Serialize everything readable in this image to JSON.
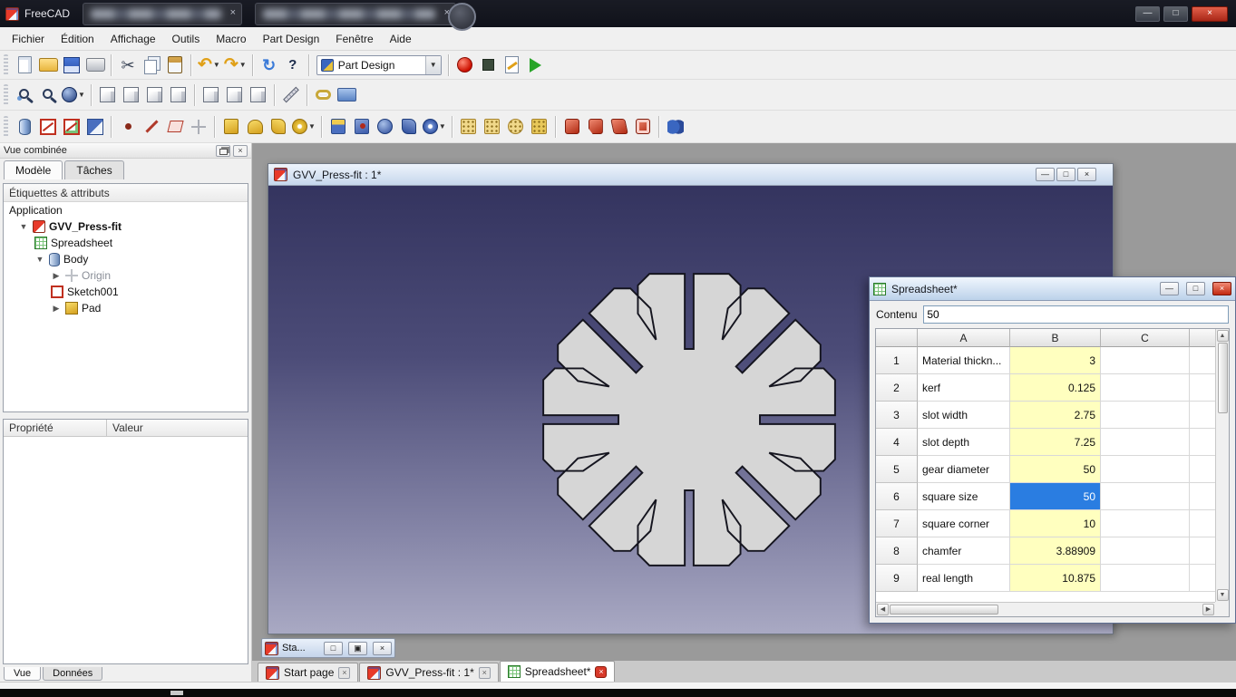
{
  "app": {
    "title": "FreeCAD"
  },
  "menubar": {
    "items": [
      "Fichier",
      "Édition",
      "Affichage",
      "Outils",
      "Macro",
      "Part Design",
      "Fenêtre",
      "Aide"
    ]
  },
  "toolbar": {
    "workbench": "Part Design"
  },
  "toolbars": {
    "row1a": [
      "grip",
      {
        "name": "new-file-button",
        "kind": "page"
      },
      {
        "name": "open-file-button",
        "kind": "folder"
      },
      {
        "name": "save-button",
        "kind": "floppy"
      },
      {
        "name": "print-button",
        "kind": "printer"
      },
      "sep",
      {
        "name": "cut-button",
        "kind": "scissors"
      },
      {
        "name": "copy-button",
        "kind": "copy"
      },
      {
        "name": "paste-button",
        "kind": "paste"
      },
      "sep",
      {
        "name": "undo-button",
        "kind": "undo",
        "drop": true
      },
      {
        "name": "redo-button",
        "kind": "redo",
        "drop": true
      },
      "sep",
      {
        "name": "refresh-button",
        "kind": "refresh"
      },
      {
        "name": "whats-this-button",
        "kind": "whatsthis"
      },
      "sep"
    ],
    "row1b": [
      "sep",
      {
        "name": "macro-record-button",
        "kind": "record"
      },
      {
        "name": "macro-stop-button",
        "kind": "stop"
      },
      {
        "name": "macro-edit-button",
        "kind": "macroedit"
      },
      {
        "name": "macro-run-button",
        "kind": "play"
      }
    ],
    "row2": [
      "grip",
      {
        "name": "fit-all-button",
        "kind": "magbox"
      },
      {
        "name": "zoom-selection-button",
        "kind": "mag"
      },
      {
        "name": "draw-style-button",
        "kind": "sphere",
        "drop": true
      },
      "sep",
      {
        "name": "view-axonometric-button",
        "kind": "cube"
      },
      {
        "name": "view-front-button",
        "kind": "cube"
      },
      {
        "name": "view-top-button",
        "kind": "cube"
      },
      {
        "name": "view-right-button",
        "kind": "cube"
      },
      "sep",
      {
        "name": "view-rear-button",
        "kind": "cube"
      },
      {
        "name": "view-bottom-button",
        "kind": "cube"
      },
      {
        "name": "view-left-button",
        "kind": "cube"
      },
      "sep",
      {
        "name": "measure-button",
        "kind": "measure"
      },
      "sep",
      {
        "name": "make-link-button",
        "kind": "link"
      },
      {
        "name": "link-group-button",
        "kind": "linkfolder"
      }
    ],
    "row3": [
      "grip",
      {
        "name": "create-body-button",
        "kind": "body"
      },
      {
        "name": "create-sketch-button",
        "kind": "sketch"
      },
      {
        "name": "edit-sketch-button",
        "kind": "editsketch"
      },
      {
        "name": "map-sketch-button",
        "kind": "mapsketch"
      },
      "sep",
      {
        "name": "datum-point-button",
        "kind": "point"
      },
      {
        "name": "datum-line-button",
        "kind": "line"
      },
      {
        "name": "datum-plane-button",
        "kind": "plane"
      },
      {
        "name": "local-cs-button",
        "kind": "cs"
      },
      "sep",
      {
        "name": "pad-button",
        "kind": "pad"
      },
      {
        "name": "revolution-button",
        "kind": "rev"
      },
      {
        "name": "additive-loft-button",
        "kind": "loft"
      },
      {
        "name": "additive-pipe-button",
        "kind": "pipe",
        "drop": true
      },
      "sep",
      {
        "name": "pocket-button",
        "kind": "pocket"
      },
      {
        "name": "hole-button",
        "kind": "hole"
      },
      {
        "name": "groove-button",
        "kind": "groove"
      },
      {
        "name": "subtractive-loft-button",
        "kind": "sloft"
      },
      {
        "name": "subtractive-pipe-button",
        "kind": "spipe",
        "drop": true
      },
      "sep",
      {
        "name": "mirrored-button",
        "kind": "mirror"
      },
      {
        "name": "linear-pattern-button",
        "kind": "lpattern"
      },
      {
        "name": "polar-pattern-button",
        "kind": "ppattern"
      },
      {
        "name": "multitransform-button",
        "kind": "multi"
      },
      "sep",
      {
        "name": "fillet-button",
        "kind": "fillet"
      },
      {
        "name": "chamfer-button",
        "kind": "chamfer"
      },
      {
        "name": "draft-button",
        "kind": "draft"
      },
      {
        "name": "thickness-button",
        "kind": "thickness"
      },
      "sep",
      {
        "name": "boolean-button",
        "kind": "boolean"
      }
    ]
  },
  "combined_view": {
    "title": "Vue combinée",
    "tabs": [
      "Modèle",
      "Tâches"
    ],
    "tree_header": "Étiquettes & attributs",
    "tree": {
      "root": "Application",
      "document": "GVV_Press-fit",
      "items": [
        "Spreadsheet",
        "Body",
        "Origin",
        "Sketch001",
        "Pad"
      ]
    },
    "property_table": {
      "columns": [
        "Propriété",
        "Valeur"
      ]
    },
    "bottom_tabs": [
      "Vue",
      "Données"
    ]
  },
  "document_window": {
    "title": "GVV_Press-fit : 1*"
  },
  "minimized_window": {
    "title": "Sta..."
  },
  "mdi_tabs": [
    {
      "label": "Start page"
    },
    {
      "label": "GVV_Press-fit : 1*"
    },
    {
      "label": "Spreadsheet*",
      "active": true
    }
  ],
  "spreadsheet": {
    "title": "Spreadsheet*",
    "content_label": "Contenu",
    "content_value": "50",
    "columns": [
      "A",
      "B",
      "C"
    ],
    "rows": [
      {
        "n": "1",
        "a": "Material thickn...",
        "b": "3"
      },
      {
        "n": "2",
        "a": "kerf",
        "b": "0.125"
      },
      {
        "n": "3",
        "a": "slot width",
        "b": "2.75"
      },
      {
        "n": "4",
        "a": "slot depth",
        "b": "7.25"
      },
      {
        "n": "5",
        "a": "gear diameter",
        "b": "50"
      },
      {
        "n": "6",
        "a": "square size",
        "b": "50",
        "selected": true
      },
      {
        "n": "7",
        "a": "square corner",
        "b": "10"
      },
      {
        "n": "8",
        "a": "chamfer",
        "b": "3.88909"
      },
      {
        "n": "9",
        "a": "real length",
        "b": "10.875"
      }
    ]
  },
  "colors": {
    "selection_blue": "#2a7de1",
    "cell_yellow": "#ffffbf",
    "viewport_top": "#34345f",
    "viewport_bottom": "#a9a9c3",
    "shape_fill": "#d6d6d6"
  }
}
